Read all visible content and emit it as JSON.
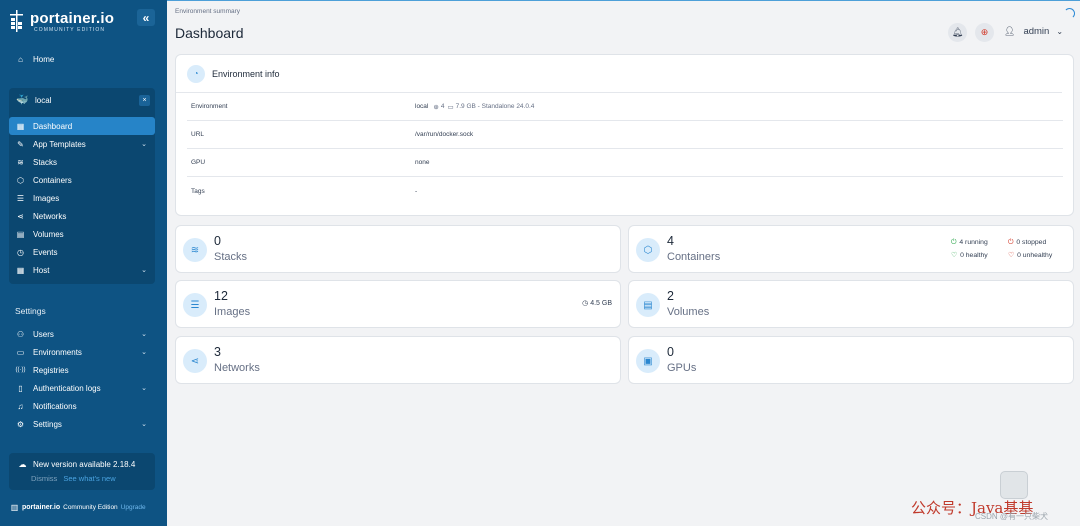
{
  "sidebar": {
    "logo_text": "portainer.io",
    "logo_sub": "COMMUNITY EDITION",
    "collapse_glyph": "«",
    "home": {
      "icon": "home-icon",
      "label": "Home"
    },
    "env": {
      "name": "local",
      "close_glyph": "×",
      "items": [
        {
          "label": "Dashboard",
          "icon": "dashboard-icon",
          "active": true,
          "expandable": false
        },
        {
          "label": "App Templates",
          "icon": "edit-icon",
          "expandable": true
        },
        {
          "label": "Stacks",
          "icon": "layers-icon",
          "expandable": false
        },
        {
          "label": "Containers",
          "icon": "box-icon",
          "expandable": false
        },
        {
          "label": "Images",
          "icon": "list-icon",
          "expandable": false
        },
        {
          "label": "Networks",
          "icon": "share-icon",
          "expandable": false
        },
        {
          "label": "Volumes",
          "icon": "database-icon",
          "expandable": false
        },
        {
          "label": "Events",
          "icon": "clock-icon",
          "expandable": false
        },
        {
          "label": "Host",
          "icon": "grid-icon",
          "expandable": true
        }
      ]
    },
    "settings_label": "Settings",
    "settings_items": [
      {
        "label": "Users",
        "icon": "users-icon",
        "expandable": true
      },
      {
        "label": "Environments",
        "icon": "hdd-icon",
        "expandable": true
      },
      {
        "label": "Registries",
        "icon": "radio-icon",
        "expandable": false
      },
      {
        "label": "Authentication logs",
        "icon": "file-icon",
        "expandable": true
      },
      {
        "label": "Notifications",
        "icon": "bell-icon",
        "expandable": false
      },
      {
        "label": "Settings",
        "icon": "gear-icon",
        "expandable": true
      }
    ],
    "update": {
      "title": "New version available 2.18.4",
      "dismiss": "Dismiss",
      "whats_new": "See what's new"
    },
    "footer": {
      "brand": "portainer.io",
      "edition": "Community Edition",
      "upgrade": "Upgrade"
    }
  },
  "header": {
    "breadcrumb": "Environment summary",
    "title": "Dashboard",
    "user": "admin"
  },
  "env_info": {
    "title": "Environment info",
    "rows": [
      {
        "key": "Environment",
        "value": "local",
        "extra": "4",
        "extra2": "7.9 GB - Standalone 24.0.4"
      },
      {
        "key": "URL",
        "value": "/var/run/docker.sock"
      },
      {
        "key": "GPU",
        "value": "none"
      },
      {
        "key": "Tags",
        "value": "-"
      }
    ]
  },
  "stats": {
    "stacks": {
      "count": "0",
      "label": "Stacks"
    },
    "containers": {
      "count": "4",
      "label": "Containers",
      "running": "4 running",
      "stopped": "0 stopped",
      "healthy": "0 healthy",
      "unhealthy": "0 unhealthy"
    },
    "images": {
      "count": "12",
      "label": "Images",
      "size": "4.5 GB"
    },
    "volumes": {
      "count": "2",
      "label": "Volumes"
    },
    "networks": {
      "count": "3",
      "label": "Networks"
    },
    "gpus": {
      "count": "0",
      "label": "GPUs"
    }
  },
  "watermark": {
    "text": "公众号：Java基基",
    "small": "CSDN @有一只柴犬"
  },
  "colors": {
    "sidebar": "#0e5383",
    "sidebar_panel": "#0b4770",
    "active": "#2684c8",
    "accent": "#2a87d0",
    "running": "#2fa84f",
    "stopped": "#d23a2a"
  }
}
